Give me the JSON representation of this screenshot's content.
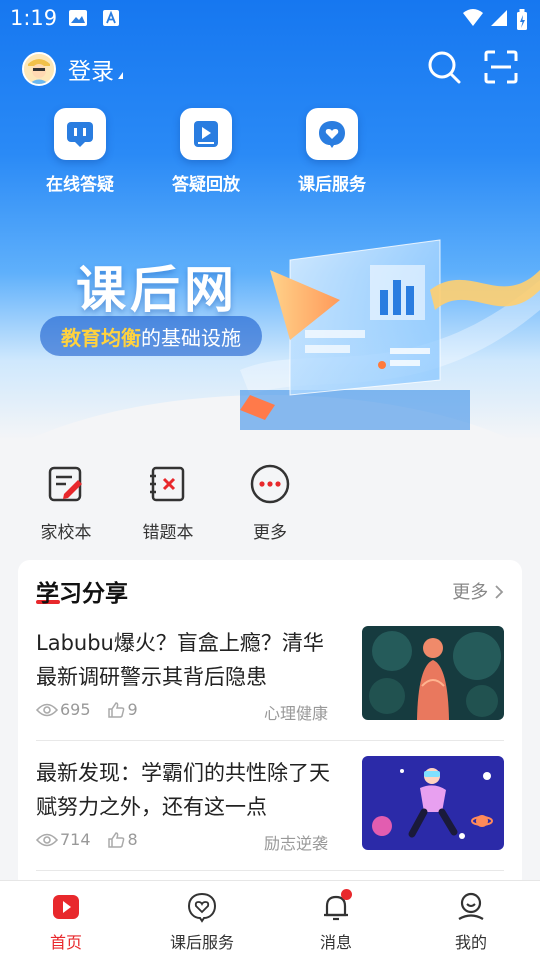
{
  "status_bar": {
    "time": "1:19"
  },
  "header": {
    "login_label": "登录"
  },
  "quick_actions": [
    {
      "label": "在线答疑",
      "icon": "chat-icon"
    },
    {
      "label": "答疑回放",
      "icon": "playback-icon"
    },
    {
      "label": "课后服务",
      "icon": "heart-icon"
    }
  ],
  "banner": {
    "title": "课后网",
    "slogan_highlight": "教育均衡",
    "slogan_rest": "的基础设施"
  },
  "tools": [
    {
      "label": "家校本",
      "icon": "notebook-edit-icon"
    },
    {
      "label": "错题本",
      "icon": "wrong-answer-icon"
    },
    {
      "label": "更多",
      "icon": "more-icon"
    }
  ],
  "section": {
    "title": "学习分享",
    "more_label": "更多",
    "articles": [
      {
        "title": "Labubu爆火？盲盒上瘾？清华最新调研警示其背后隐患",
        "views": "695",
        "likes": "9",
        "tag": "心理健康"
      },
      {
        "title": "最新发现：学霸们的共性除了天赋努力之外，还有这一点",
        "views": "714",
        "likes": "8",
        "tag": "励志逆袭"
      }
    ]
  },
  "bottom_nav": [
    {
      "label": "首页",
      "icon": "home-icon",
      "active": true
    },
    {
      "label": "课后服务",
      "icon": "heart-icon"
    },
    {
      "label": "消息",
      "icon": "bell-icon",
      "badge": true
    },
    {
      "label": "我的",
      "icon": "profile-icon"
    }
  ],
  "colors": {
    "primary_blue": "#1677f0",
    "accent_red": "#e8282c",
    "slogan_yellow": "#ffd23f"
  }
}
